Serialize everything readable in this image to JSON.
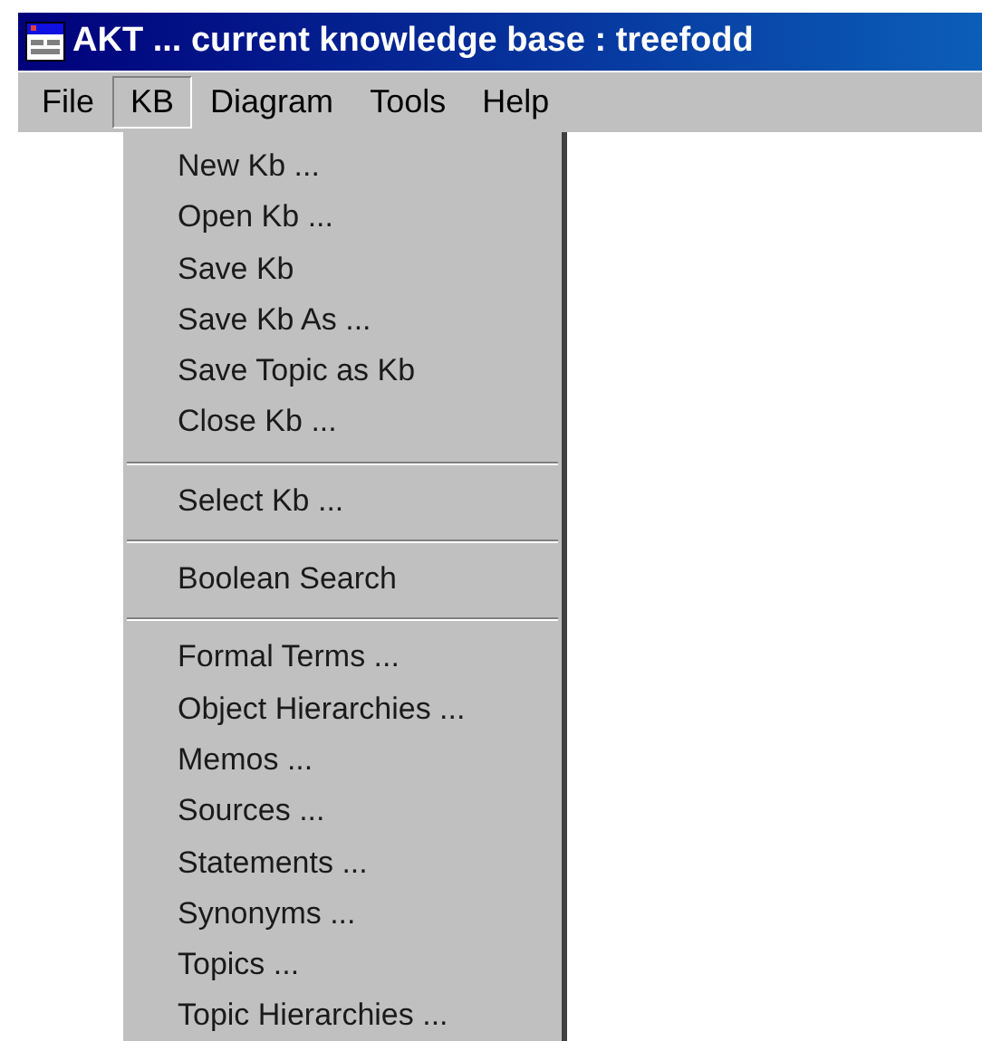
{
  "window": {
    "title": "AKT ... current knowledge base : treefodd"
  },
  "menu_bar": [
    {
      "label": "File",
      "selected": false
    },
    {
      "label": "KB",
      "selected": true
    },
    {
      "label": "Diagram",
      "selected": false
    },
    {
      "label": "Tools",
      "selected": false
    },
    {
      "label": "Help",
      "selected": false
    }
  ],
  "dropdown": {
    "groups": [
      [
        "New Kb ...",
        "Open Kb ...",
        "Save Kb",
        "Save Kb As ...",
        "Save Topic as Kb",
        "Close Kb ..."
      ],
      [
        "Select Kb ..."
      ],
      [
        "Boolean Search"
      ],
      [
        "Formal Terms ...",
        "Object Hierarchies ...",
        "Memos ...",
        "Sources ...",
        "Statements ...",
        "Synonyms ...",
        "Topics ...",
        "Topic Hierarchies ..."
      ]
    ]
  }
}
